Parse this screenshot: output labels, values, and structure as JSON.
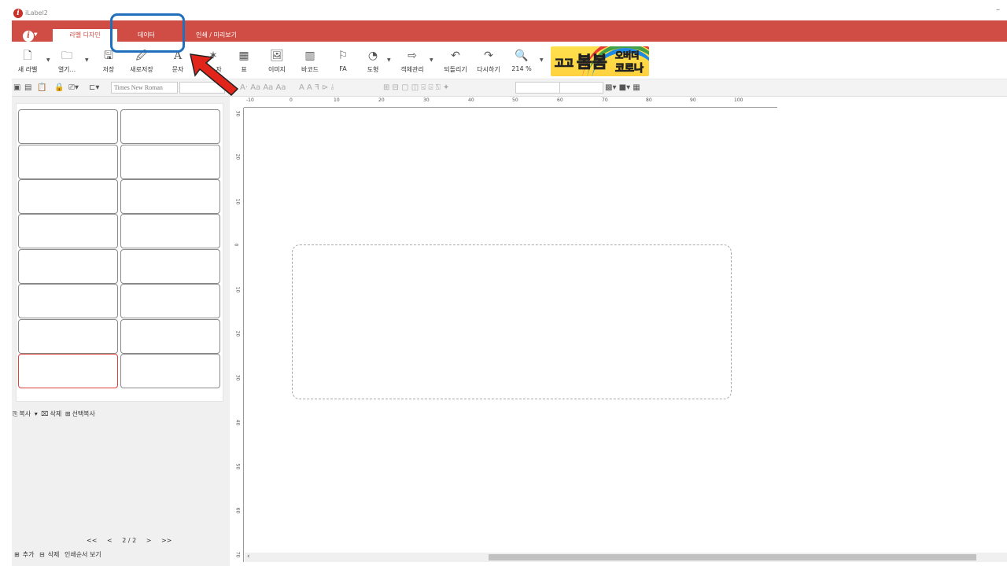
{
  "window": {
    "title": "iLabel2",
    "minimize": "–"
  },
  "tabs": {
    "design": "라벨 디자인",
    "data": "데이터",
    "print": "인쇄 / 미리보기"
  },
  "toolbar": {
    "new_label": "새 라벨",
    "open": "열기...",
    "save": "저장",
    "save_as": "새로저장",
    "text": "문자",
    "magic": "자",
    "table": "표",
    "image": "이미지",
    "barcode": "바코드",
    "fa": "FA",
    "shape": "도형",
    "object_mgmt": "객체관리",
    "undo": "되돌리기",
    "redo": "다시하기",
    "zoom": "214 %"
  },
  "banner": {
    "w1": "고고",
    "w2": "봄봄",
    "w3": "오버더",
    "w4": "코로나"
  },
  "formatbar": {
    "font": "Times New Roman"
  },
  "left_panel": {
    "copy": "복사",
    "delete": "삭제",
    "select_copy": "선택복사",
    "pager": {
      "first": "<<",
      "prev": "<",
      "page": "2 / 2",
      "next": ">",
      "last": ">>"
    },
    "add": "추가",
    "delete2": "삭제",
    "print_order": "인쇄순서 보기"
  },
  "ruler": {
    "top": [
      "-10",
      "0",
      "10",
      "20",
      "30",
      "40",
      "50",
      "60",
      "70",
      "80",
      "90",
      "100"
    ],
    "left": [
      "30",
      "20",
      "10",
      "0",
      "10",
      "20",
      "30",
      "40",
      "50",
      "60",
      "70"
    ]
  }
}
